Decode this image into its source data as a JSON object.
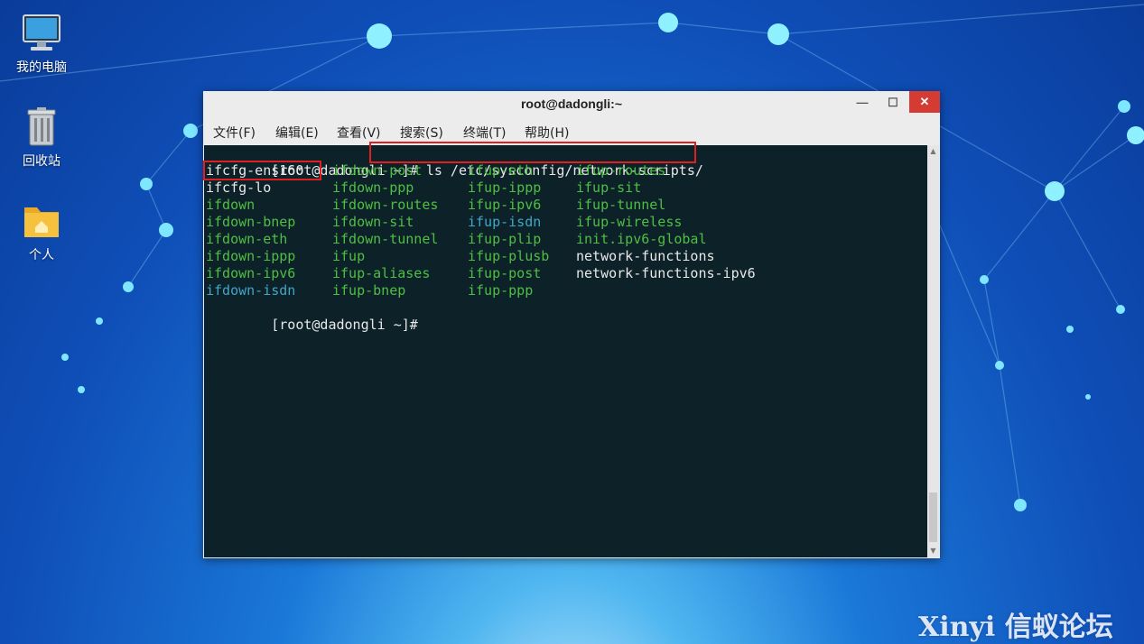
{
  "desktop": {
    "icons": [
      {
        "label": "我的电脑",
        "icon": "computer-icon"
      },
      {
        "label": "回收站",
        "icon": "trash-icon"
      },
      {
        "label": "个人",
        "icon": "home-folder-icon"
      }
    ],
    "watermark": "Xinyi 信蚁论坛"
  },
  "window": {
    "title": "root@dadongli:~",
    "controls": {
      "minimize": "—",
      "maximize": "☐",
      "close": "✕"
    },
    "menu": [
      "文件(F)",
      "编辑(E)",
      "查看(V)",
      "搜索(S)",
      "终端(T)",
      "帮助(H)"
    ]
  },
  "terminal": {
    "prompt": "[root@dadongli ~]#",
    "command": " ls /etc/sysconfig/network-scripts/",
    "listing": [
      [
        {
          "t": "ifcfg-ens160",
          "c": "white"
        },
        {
          "t": "ifdown-post",
          "c": "green"
        },
        {
          "t": "ifup-eth",
          "c": "green"
        },
        {
          "t": "ifup-routes",
          "c": "green"
        }
      ],
      [
        {
          "t": "ifcfg-lo",
          "c": "white"
        },
        {
          "t": "ifdown-ppp",
          "c": "green"
        },
        {
          "t": "ifup-ippp",
          "c": "green"
        },
        {
          "t": "ifup-sit",
          "c": "green"
        }
      ],
      [
        {
          "t": "ifdown",
          "c": "green"
        },
        {
          "t": "ifdown-routes",
          "c": "green"
        },
        {
          "t": "ifup-ipv6",
          "c": "green"
        },
        {
          "t": "ifup-tunnel",
          "c": "green"
        }
      ],
      [
        {
          "t": "ifdown-bnep",
          "c": "green"
        },
        {
          "t": "ifdown-sit",
          "c": "green"
        },
        {
          "t": "ifup-isdn",
          "c": "cyan"
        },
        {
          "t": "ifup-wireless",
          "c": "green"
        }
      ],
      [
        {
          "t": "ifdown-eth",
          "c": "green"
        },
        {
          "t": "ifdown-tunnel",
          "c": "green"
        },
        {
          "t": "ifup-plip",
          "c": "green"
        },
        {
          "t": "init.ipv6-global",
          "c": "green"
        }
      ],
      [
        {
          "t": "ifdown-ippp",
          "c": "green"
        },
        {
          "t": "ifup",
          "c": "green"
        },
        {
          "t": "ifup-plusb",
          "c": "green"
        },
        {
          "t": "network-functions",
          "c": "white"
        }
      ],
      [
        {
          "t": "ifdown-ipv6",
          "c": "green"
        },
        {
          "t": "ifup-aliases",
          "c": "green"
        },
        {
          "t": "ifup-post",
          "c": "green"
        },
        {
          "t": "network-functions-ipv6",
          "c": "white"
        }
      ],
      [
        {
          "t": "ifdown-isdn",
          "c": "cyan"
        },
        {
          "t": "ifup-bnep",
          "c": "green"
        },
        {
          "t": "ifup-ppp",
          "c": "green"
        }
      ]
    ],
    "colors": {
      "green": "#4fbf44",
      "cyan": "#3fa7c8",
      "white": "#e8e8e8",
      "background": "#0d2129",
      "highlight": "#e02020"
    }
  }
}
